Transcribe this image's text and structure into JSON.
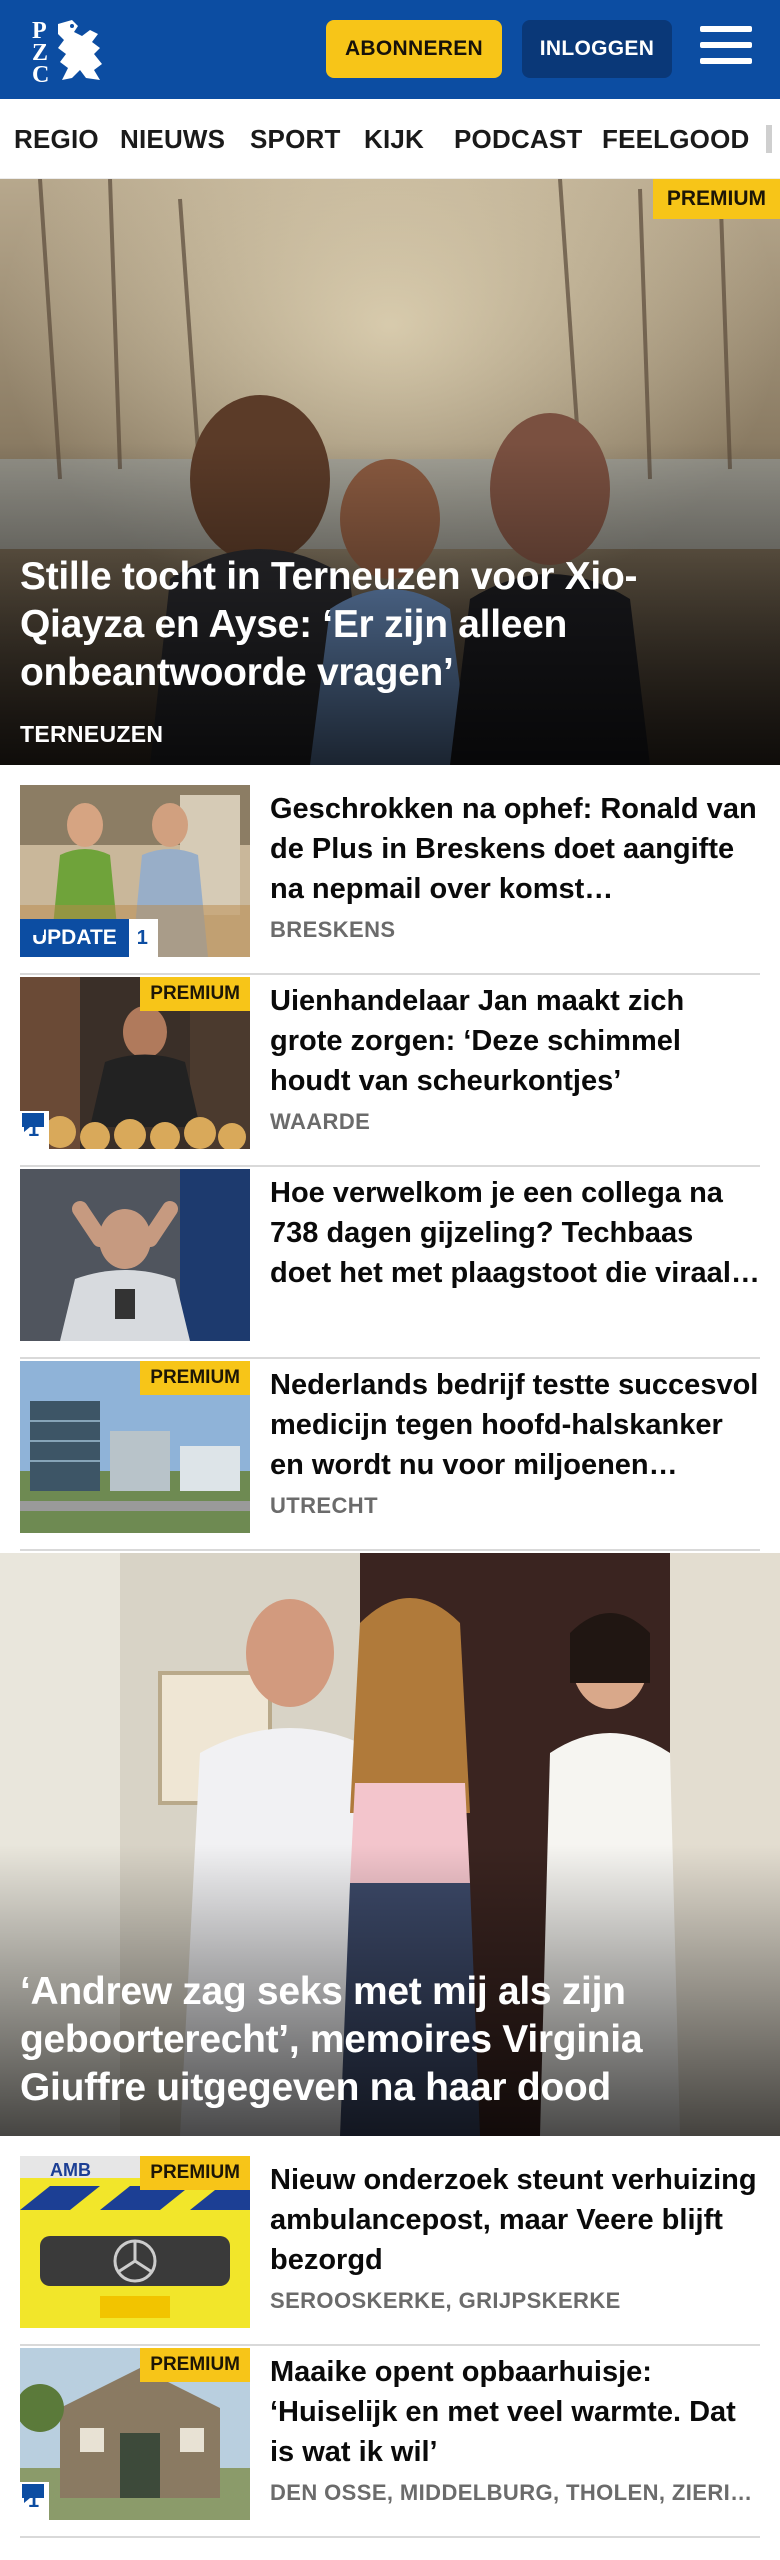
{
  "header": {
    "subscribe_label": "ABONNEREN",
    "login_label": "INLOGGEN",
    "logo_letters": [
      "P",
      "Z",
      "C"
    ],
    "brand_color": "#0c4da2",
    "accent_color": "#f7c518"
  },
  "nav": {
    "items": [
      {
        "label": "REGIO"
      },
      {
        "label": "NIEUWS"
      },
      {
        "label": "SPORT"
      },
      {
        "label": "KIJK"
      },
      {
        "label": "PODCAST"
      },
      {
        "label": "FEELGOOD"
      }
    ]
  },
  "hero1": {
    "premium_label": "PREMIUM",
    "title": "Stille tocht in Terneuzen voor Xio-Qiayza en Ayse: ‘Er zijn alleen onbeantwoorde vragen’",
    "place": "TERNEUZEN"
  },
  "articles": [
    {
      "title": "Geschrokken na ophef: Ronald van de Plus in Breskens doet aangifte na nepmail over komst asielzoekers",
      "place": "BRESKENS",
      "update_label": "UPDATE",
      "comments": "1"
    },
    {
      "title": "Uienhandelaar Jan maakt zich grote zorgen: ‘Deze schimmel houdt van scheurkontjes’",
      "place": "WAARDE",
      "premium_label": "PREMIUM",
      "comments": "1"
    },
    {
      "title": "Hoe verwelkom je een collega na 738 dagen gijzeling? Techbaas doet het met plaagstoot die viraal gaat",
      "place": ""
    },
    {
      "title": "Nederlands bedrijf testte succesvol medicijn tegen hoofd-halskanker en wordt nu voor miljoenen overgenomen",
      "place": "UTRECHT",
      "premium_label": "PREMIUM"
    }
  ],
  "hero2": {
    "title": "‘Andrew zag seks met mij als zijn geboorterecht’, memoires Virginia Giuffre uitgegeven na haar dood"
  },
  "articles2": [
    {
      "title": "Nieuw onderzoek steunt verhuizing ambulancepost, maar Veere blijft bezorgd",
      "place": "SEROOSKERKE, GRIJPSKERKE",
      "premium_label": "PREMIUM",
      "thumb_text": "AMB"
    },
    {
      "title": "Maaike opent opbaarhuisje: ‘Huiselijk en met veel warmte. Dat is wat ik wil’",
      "place": "DEN OSSE, MIDDELBURG, THOLEN, ZIERIKZEE",
      "premium_label": "PREMIUM",
      "comments": "1"
    }
  ]
}
